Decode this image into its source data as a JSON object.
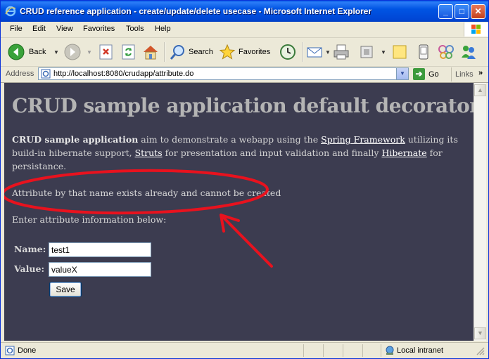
{
  "window": {
    "title": "CRUD reference application - create/update/delete usecase - Microsoft Internet Explorer",
    "buttons": {
      "minimize": "_",
      "maximize": "□",
      "close": "✕"
    }
  },
  "menu": [
    "File",
    "Edit",
    "View",
    "Favorites",
    "Tools",
    "Help"
  ],
  "toolbar": {
    "back_label": "Back",
    "search_label": "Search",
    "favorites_label": "Favorites"
  },
  "address": {
    "label": "Address",
    "url": "http://localhost:8080/crudapp/attribute.do",
    "go_label": "Go",
    "links_label": "Links"
  },
  "page": {
    "heading": "CRUD sample application default decorator",
    "intro": {
      "bold": "CRUD sample application",
      "t1": " aim to demonstrate a webapp using the ",
      "link1": "Spring Framework",
      "t2": " utilizing its build-in hibernate support, ",
      "link2": "Struts",
      "t3": " for presentation and input validation and finally ",
      "link3": "Hibernate",
      "t4": " for persistance."
    },
    "error_message": "Attribute by that name exists already and cannot be created",
    "instructions": "Enter attribute information below:",
    "form": {
      "name_label": "Name:",
      "name_value": "test1",
      "value_label": "Value:",
      "value_value": "valueX",
      "save_label": "Save"
    }
  },
  "status": {
    "text": "Done",
    "zone": "Local intranet"
  },
  "colors": {
    "content_bg": "#3c3c50",
    "annotation": "#e8121e",
    "titlebar": "#0054e3"
  }
}
